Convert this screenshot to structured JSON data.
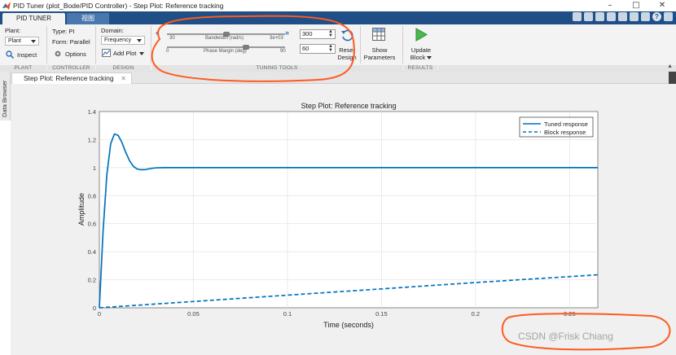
{
  "window": {
    "title": "PID Tuner (plot_Bode/PID Controller) - Step Plot: Reference tracking",
    "minimize": "–",
    "maximize": "□",
    "close": "✕"
  },
  "tabs": [
    {
      "label": "PID TUNER",
      "active": true
    },
    {
      "label": "视图",
      "active": false
    }
  ],
  "toolstrip": {
    "plant_label": "Plant:",
    "plant_value": "Plant",
    "inspect_label": "Inspect",
    "type_label": "Type: PI",
    "form_label": "Form: Parallel",
    "options_label": "Options",
    "domain_label": "Domain:",
    "domain_value": "Frequency",
    "add_plot_label": "Add Plot",
    "bandwidth": {
      "label": "Bandwidth (rad/s)",
      "min": "30",
      "max": "3e+03",
      "value": "300",
      "level_fraction": 0.5
    },
    "phase_margin": {
      "label": "Phase Margin (deg)",
      "min": "0",
      "max": "90",
      "value": "60",
      "level_fraction": 0.667
    },
    "reset_design_label_1": "Reset",
    "reset_design_label_2": "Design",
    "show_params_label_1": "Show",
    "show_params_label_2": "Parameters",
    "update_block_label_1": "Update",
    "update_block_label_2": "Block",
    "groups": {
      "plant": "PLANT",
      "controller": "CONTROLLER",
      "design": "DESIGN",
      "tuning": "TUNING TOOLS",
      "results": "RESULTS"
    }
  },
  "document_tab": {
    "label": "Step Plot: Reference tracking"
  },
  "sidebar": {
    "label": "Data Browser"
  },
  "chart_data": {
    "type": "line",
    "title": "Step Plot: Reference tracking",
    "xlabel": "Time (seconds)",
    "ylabel": "Amplitude",
    "xlim": [
      0,
      0.265
    ],
    "ylim": [
      0,
      1.4
    ],
    "xticks": [
      "0",
      "0.05",
      "0.1",
      "0.15",
      "0.2",
      "0.25"
    ],
    "yticks": [
      "0",
      "0.2",
      "0.4",
      "0.6",
      "0.8",
      "1",
      "1.2",
      "1.4"
    ],
    "grid": true,
    "legend_position": "top-right",
    "series": [
      {
        "name": "Tuned response",
        "style": "solid",
        "color": "#0072bd",
        "x": [
          0,
          0.002,
          0.004,
          0.006,
          0.008,
          0.01,
          0.012,
          0.014,
          0.016,
          0.018,
          0.02,
          0.022,
          0.024,
          0.026,
          0.028,
          0.03,
          0.034,
          0.04,
          0.05,
          0.07,
          0.1,
          0.15,
          0.2,
          0.265
        ],
        "y": [
          0,
          0.55,
          0.95,
          1.17,
          1.24,
          1.23,
          1.18,
          1.11,
          1.05,
          1.01,
          0.99,
          0.985,
          0.985,
          0.99,
          0.995,
          0.998,
          1.0,
          1.0,
          1.0,
          1.0,
          1.0,
          1.0,
          1.0,
          1.0
        ]
      },
      {
        "name": "Block response",
        "style": "dashed",
        "color": "#0072bd",
        "x": [
          0,
          0.05,
          0.1,
          0.15,
          0.2,
          0.265
        ],
        "y": [
          0,
          0.045,
          0.09,
          0.135,
          0.18,
          0.235
        ]
      }
    ]
  },
  "watermark": "CSDN @Frisk Chiang",
  "colors": {
    "accent": "#1f4f86",
    "annotation": "#ff5a1f",
    "series": "#0072bd"
  }
}
